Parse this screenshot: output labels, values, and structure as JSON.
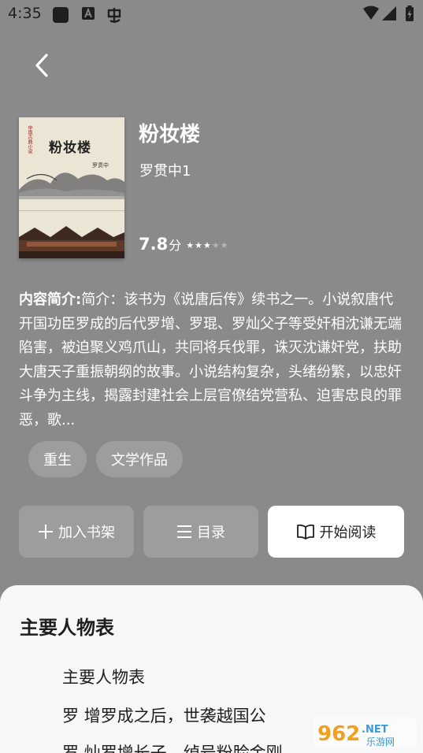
{
  "status_bar": {
    "time": "4:35",
    "icons": [
      "app-square-icon",
      "a-box-icon",
      "bug-icon",
      "wifi-icon",
      "signal-icon",
      "battery-charging-icon"
    ]
  },
  "nav": {
    "back_icon": "chevron-left-icon"
  },
  "book": {
    "cover": {
      "title": "粉妆楼",
      "series": "中国古典小说",
      "author": "罗贯中"
    },
    "title": "粉妆楼",
    "author": "罗贯中1",
    "rating": "7.8",
    "rating_unit": "分",
    "stars_filled": 3,
    "stars_total": 5,
    "description_label": "内容简介:",
    "description": "简介：该书为《说唐后传》续书之一。小说叙唐代开国功臣罗成的后代罗增、罗琨、罗灿父子等受奸相沈谦无端陷害，被迫聚义鸡爪山，共同将兵伐罪，诛灭沈谦奸党，扶助大唐天子重振朝纲的故事。小说结构复杂，头绪纷繁，以忠奸斗争为主线，揭露封建社会上层官僚结党营私、迫害忠良的罪恶，歌..."
  },
  "tags": [
    "重生",
    "文学作品"
  ],
  "actions": {
    "add_shelf": {
      "icon": "plus-icon",
      "label": "加入书架"
    },
    "toc": {
      "icon": "list-icon",
      "label": "目录"
    },
    "read": {
      "icon": "open-book-icon",
      "label": "开始阅读"
    }
  },
  "sheet": {
    "title": "主要人物表",
    "lines": [
      "主要人物表",
      "罗 增罗成之后，世袭越国公",
      "罗 灿罗增长子，绰号粉脸金刚"
    ]
  },
  "watermark": {
    "text1": "962",
    "text2": ".NET",
    "text3": "乐游网"
  },
  "colors": {
    "background": "#8a8a8a",
    "button": "#9d9d9d",
    "sheet": "#f7f7f7",
    "text_dark": "#1e1e1e"
  }
}
